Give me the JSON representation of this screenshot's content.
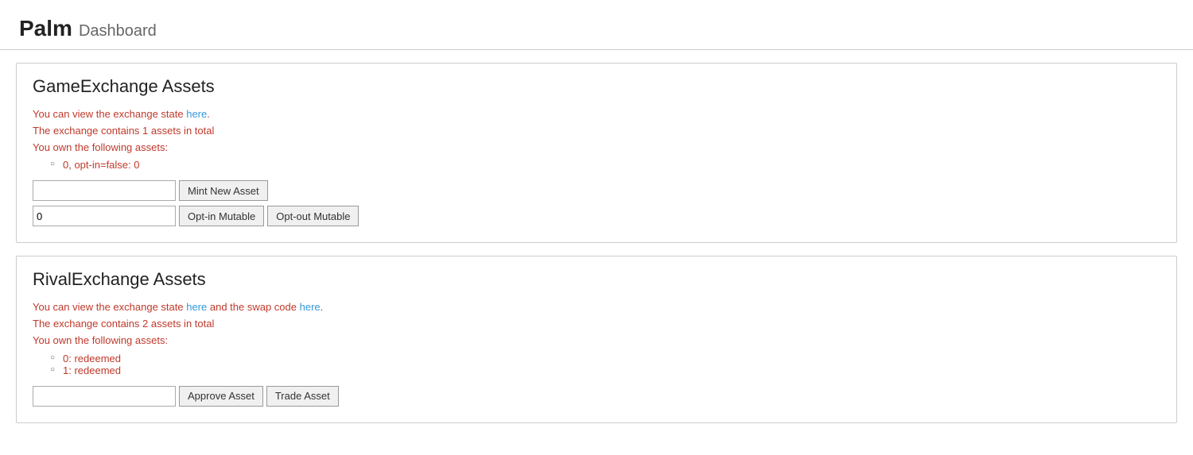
{
  "header": {
    "app_name": "Palm",
    "subtitle": "Dashboard"
  },
  "sections": [
    {
      "id": "game-exchange",
      "title": "GameExchange Assets",
      "info_line1_prefix": "You can view the exchange state ",
      "info_line1_link": "here",
      "info_line1_suffix": ".",
      "info_line2": "The exchange contains 1 assets in total",
      "info_line3": "You own the following assets:",
      "assets": [
        "0, opt-in=false: 0"
      ],
      "controls": {
        "row1": {
          "input_placeholder": "",
          "input_value": "",
          "button1_label": "Mint New Asset"
        },
        "row2": {
          "input_value": "0",
          "button1_label": "Opt-in Mutable",
          "button2_label": "Opt-out Mutable"
        }
      }
    },
    {
      "id": "rival-exchange",
      "title": "RivalExchange Assets",
      "info_line1_prefix": "You can view the exchange state ",
      "info_line1_link1": "here",
      "info_line1_middle": " and the swap code ",
      "info_line1_link2": "here",
      "info_line1_suffix": ".",
      "info_line2": "The exchange contains 2 assets in total",
      "info_line3": "You own the following assets:",
      "assets": [
        "0: redeemed",
        "1: redeemed"
      ],
      "controls": {
        "row1": {
          "input_placeholder": "",
          "input_value": "",
          "button1_label": "Approve Asset",
          "button2_label": "Trade Asset"
        }
      }
    }
  ]
}
